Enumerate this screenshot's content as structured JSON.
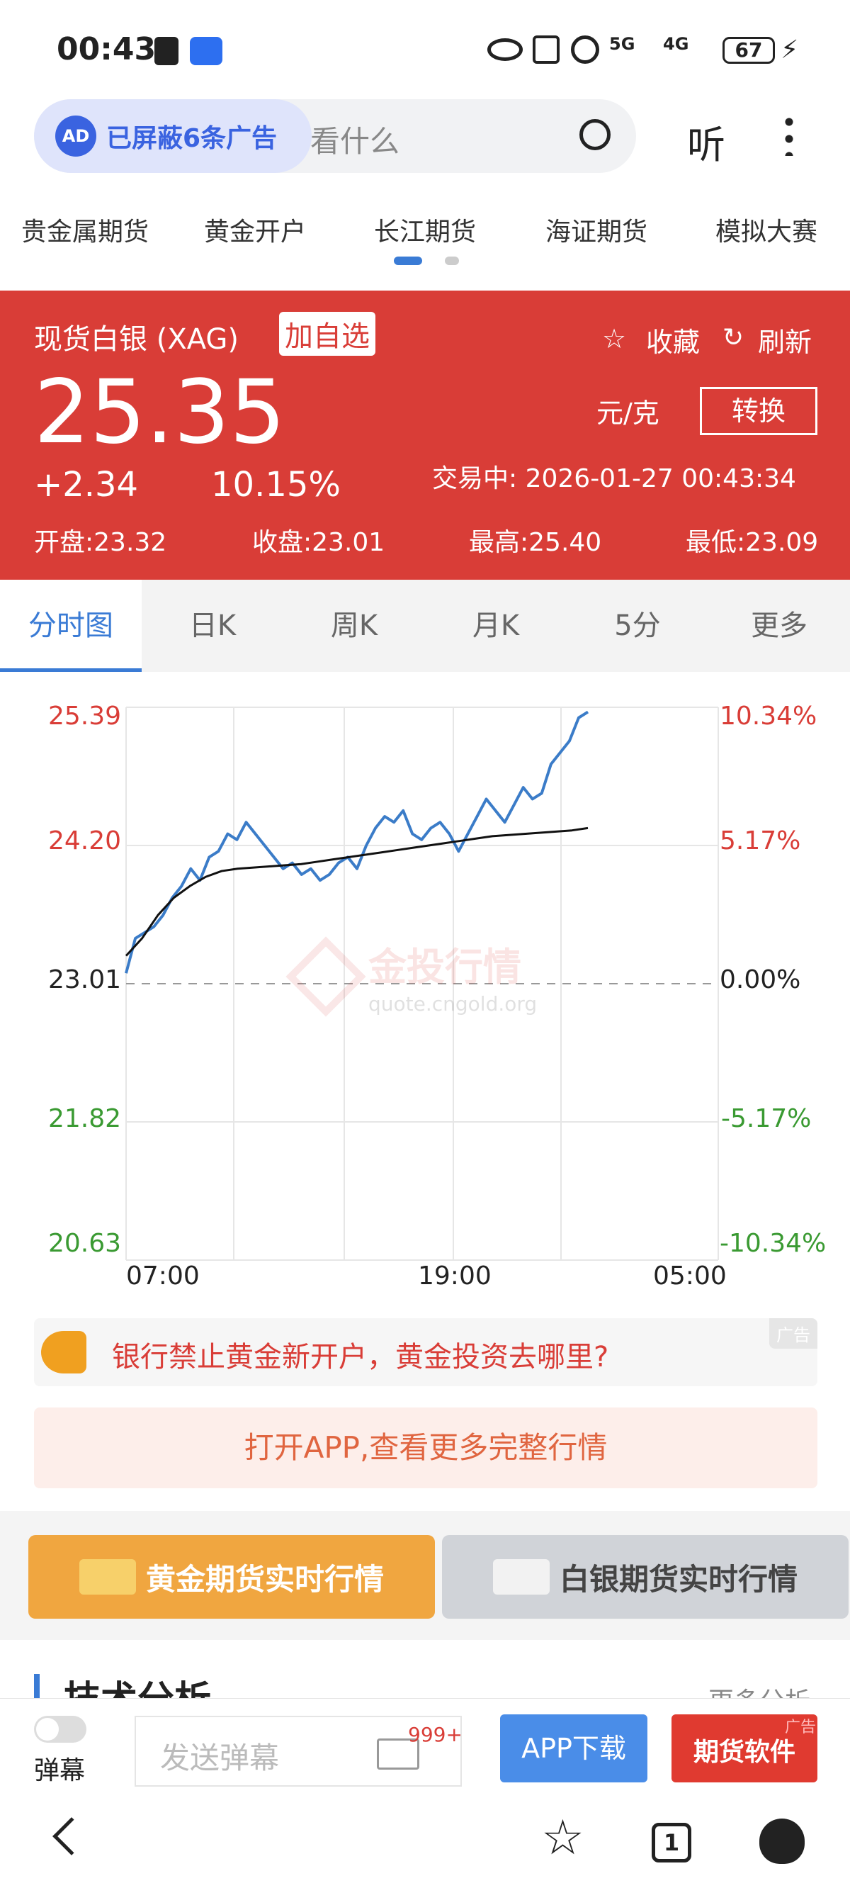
{
  "status": {
    "time": "00:43",
    "battery": "67",
    "net1": "5G",
    "net2": "4G"
  },
  "search": {
    "ad_blocked": "已屏蔽6条广告",
    "placeholder_tail": "看什么",
    "listen": "听"
  },
  "categories": [
    "贵金属期货",
    "黄金开户",
    "长江期货",
    "海证期货",
    "模拟大赛"
  ],
  "quote": {
    "name": "现货白银 (XAG)",
    "add_watch": "加自选",
    "favorite": "收藏",
    "refresh": "刷新",
    "price": "25.35",
    "unit": "元/克",
    "convert": "转换",
    "change": "+2.34",
    "change_pct": "10.15%",
    "trading": "交易中:  2026-01-27 00:43:34",
    "open": "开盘:23.32",
    "close": "收盘:23.01",
    "high": "最高:25.40",
    "low": "最低:23.09"
  },
  "tabs": [
    "分时图",
    "日K",
    "周K",
    "月K",
    "5分",
    "更多"
  ],
  "chart_data": {
    "type": "line",
    "y_left": [
      "25.39",
      "24.20",
      "23.01",
      "21.82",
      "20.63"
    ],
    "y_right": [
      "10.34%",
      "5.17%",
      "0.00%",
      "-5.17%",
      "-10.34%"
    ],
    "x_ticks": [
      "07:00",
      "19:00",
      "05:00"
    ],
    "ylim": [
      20.63,
      25.39
    ],
    "baseline": 23.01,
    "watermark": "金投行情",
    "watermark_url": "quote.cngold.org",
    "series": [
      {
        "values": [
          23.1,
          23.4,
          23.45,
          23.5,
          23.6,
          23.75,
          23.85,
          24.0,
          23.9,
          24.1,
          24.15,
          24.3,
          24.25,
          24.4,
          24.3,
          24.2,
          24.1,
          24.0,
          24.05,
          23.95,
          24.0,
          23.9,
          23.95,
          24.05,
          24.1,
          24.0,
          24.2,
          24.35,
          24.45,
          24.4,
          24.5,
          24.3,
          24.25,
          24.35,
          24.4,
          24.3,
          24.15,
          24.3,
          24.45,
          24.6,
          24.5,
          24.4,
          24.55,
          24.7,
          24.6,
          24.65,
          24.9,
          25.0,
          25.1,
          25.3,
          25.35
        ]
      },
      {
        "values": [
          23.25,
          23.4,
          23.6,
          23.75,
          23.85,
          23.93,
          23.98,
          24.0,
          24.01,
          24.02,
          24.03,
          24.04,
          24.06,
          24.08,
          24.1,
          24.12,
          24.14,
          24.16,
          24.18,
          24.2,
          24.22,
          24.24,
          24.26,
          24.28,
          24.29,
          24.3,
          24.31,
          24.32,
          24.33,
          24.35
        ]
      }
    ]
  },
  "promo": {
    "text": "银行禁止黄金新开户，黄金投资去哪里?",
    "ad": "广告"
  },
  "open_app": "打开APP,查看更多完整行情",
  "futures": {
    "gold": "黄金期货实时行情",
    "silver": "白银期货实时行情"
  },
  "section": {
    "title": "技术分析",
    "more": "更多分析"
  },
  "bottom": {
    "danmu": "弹幕",
    "send_placeholder": "发送弹幕",
    "count": "999+",
    "app_download": "APP下载",
    "futures_software": "期货软件",
    "ad": "广告"
  },
  "nav": {
    "tab_count": "1"
  }
}
